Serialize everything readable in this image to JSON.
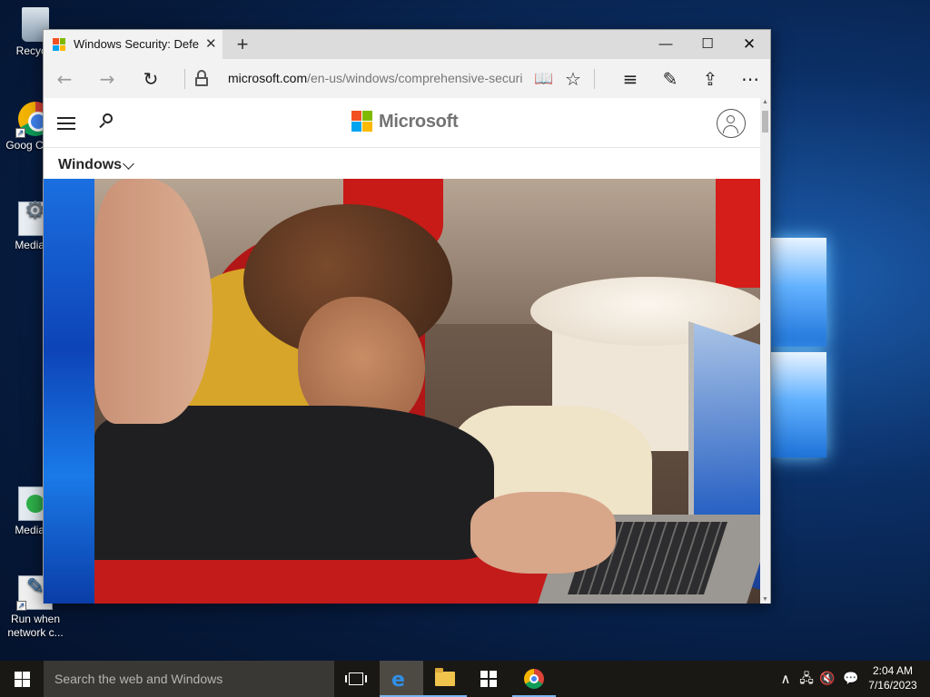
{
  "desktop": {
    "icons": [
      {
        "label": "Recycle",
        "icon": "recycle-bin-icon"
      },
      {
        "label": "Goog Chron",
        "icon": "chrome-icon"
      },
      {
        "label": "MediaCr",
        "icon": "mediacreation-tool-icon"
      },
      {
        "label": "MediaCr",
        "icon": "mediacreation-tool-icon"
      },
      {
        "label": "Run when network c...",
        "icon": "run-script-icon"
      }
    ]
  },
  "browser": {
    "tab": {
      "title": "Windows Security: Defe",
      "close": "✕"
    },
    "new_tab": "+",
    "window_controls": {
      "minimize": "—",
      "maximize": "☐",
      "close": "✕"
    },
    "nav": {
      "back": "←",
      "forward": "→",
      "refresh": "↻",
      "url_host": "microsoft.com",
      "url_path": "/en-us/windows/comprehensive-security?",
      "reading_view": "📖",
      "favorite": "☆",
      "hub": "≡",
      "notes": "✎",
      "share": "⇪",
      "more": "⋯"
    }
  },
  "page": {
    "brand": "Microsoft",
    "subnav": {
      "label": "Windows"
    },
    "hero_image": "photo of adult and child looking at a Windows 11 laptop",
    "colors": {
      "ms_red": "#f25022",
      "ms_green": "#7fba00",
      "ms_blue": "#00a4ef",
      "ms_yellow": "#ffb900",
      "accent_blue": "#1b6fe0"
    }
  },
  "taskbar": {
    "search_placeholder": "Search the web and Windows",
    "apps": [
      "task-view",
      "edge",
      "file-explorer",
      "store",
      "chrome"
    ],
    "tray": {
      "chevron": "∧",
      "network": "🖧",
      "volume": "🔇",
      "notifications": "💬"
    },
    "clock": {
      "time": "2:04 AM",
      "date": "7/16/2023"
    }
  }
}
